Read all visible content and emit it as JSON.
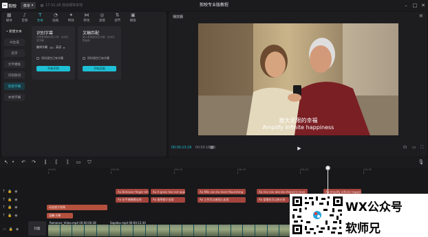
{
  "app": {
    "logo_text": "剪映",
    "menu_label": "菜单",
    "save_status": "17:31:28 自动保存本地",
    "window_title": "剪映专业版教程"
  },
  "tabs": [
    {
      "label": "媒体",
      "icon": "media-icon"
    },
    {
      "label": "音频",
      "icon": "audio-icon"
    },
    {
      "label": "文本",
      "icon": "text-icon",
      "active": true
    },
    {
      "label": "贴纸",
      "icon": "sticker-icon"
    },
    {
      "label": "特效",
      "icon": "effects-icon"
    },
    {
      "label": "转场",
      "icon": "transition-icon"
    },
    {
      "label": "滤镜",
      "icon": "filter-icon"
    },
    {
      "label": "调节",
      "icon": "adjust-icon"
    },
    {
      "label": "模板",
      "icon": "template-icon"
    }
  ],
  "sidebar": {
    "items": [
      {
        "label": "• 新建文本",
        "kind": "head"
      },
      {
        "label": "AI生成"
      },
      {
        "label": "花字"
      },
      {
        "label": "文字模板"
      },
      {
        "label": "识别歌词"
      },
      {
        "label": "智能字幕",
        "active": true
      },
      {
        "label": "本地字幕"
      }
    ]
  },
  "cards": [
    {
      "title": "识别字幕",
      "desc": "识别音视频中的人声，自动生成字幕",
      "lang_label": "翻译字幕",
      "lang_value": "英语",
      "checkbox": "同时清空已有字幕",
      "button": "开始识别"
    },
    {
      "title": "文稿匹配",
      "desc": "输入音视频对应文稿，自动匹配画面",
      "checkbox": "同时清空已有字幕",
      "button": "开始匹配"
    }
  ],
  "player": {
    "title": "播放器",
    "caption_cn": "放大无限的幸福",
    "caption_en": "Amplify infinite happiness",
    "time_current": "00:00:13:29",
    "time_total": "00:00:18:09"
  },
  "timeline": {
    "ruler": [
      "00:00",
      "|00:05",
      "|00:10",
      "|00:15",
      "|00:20",
      "|00:25"
    ],
    "sub_clips_row1": [
      "Aa Behavior finger stroke",
      "Aa A grass has not appeared",
      "Aa Milk can be more flourishing",
      "Aa rice can also be shared in love",
      "Aa Amplify infinite happiness"
    ],
    "sub_clips_row2": [
      "Aa 往手感触摸出地",
      "Aa 青草都少出现",
      "Aa 工作可以继续心出现",
      "Aa 爱情也可以和分享"
    ],
    "fx_clips": [
      "动态放大效果",
      "温馨·光晕"
    ],
    "video_label": "Romance_Video.mp4  00:00:00:28",
    "video_label2": "Sapidoc.mp4  00:00:13:30",
    "cover_label": "封面"
  },
  "watermark": {
    "line1": "WX公众号",
    "line2": "软师兄"
  }
}
